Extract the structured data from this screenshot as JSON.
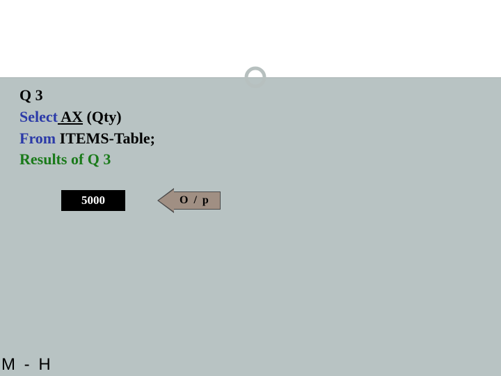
{
  "query": {
    "title": "Q 3",
    "select_kw": "Select",
    "select_fn_pre": " ",
    "select_fn": "AX",
    "select_arg": " (Qty)",
    "from_kw": "From",
    "from_rest": " ITEMS-Table;",
    "results_label": "Results of Q 3"
  },
  "result": {
    "value": "5000",
    "output_label": "O / p"
  },
  "footer": "M - H"
}
